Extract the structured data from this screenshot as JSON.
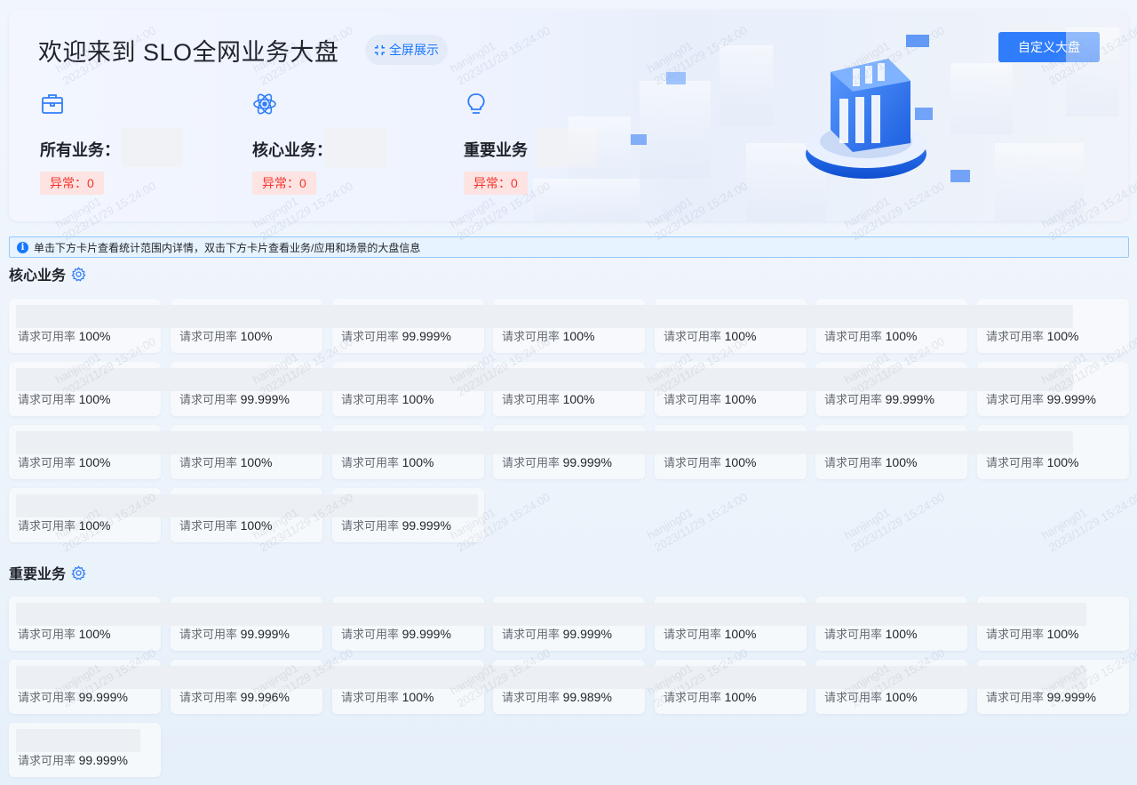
{
  "banner": {
    "title": "欢迎来到 SLO全网业务大盘",
    "fullscreen_label": "全屏展示",
    "custom_label": "自定义大盘",
    "stats": [
      {
        "label": "所有业务：",
        "abnormal": "异常：0"
      },
      {
        "label": "核心业务：",
        "abnormal": "异常：0"
      },
      {
        "label": "重要业务",
        "abnormal": "异常：0"
      }
    ]
  },
  "info": "单击下方卡片查看统计范围内详情，双击下方卡片查看业务/应用和场景的大盘信息",
  "metric_label": "请求可用率",
  "sections": [
    {
      "title": "核心业务",
      "rows": [
        [
          "100%",
          "100%",
          "99.999%",
          "100%",
          "100%",
          "100%",
          "100%"
        ],
        [
          "100%",
          "99.999%",
          "100%",
          "100%",
          "100%",
          "99.999%",
          "99.999%"
        ],
        [
          "100%",
          "100%",
          "100%",
          "99.999%",
          "100%",
          "100%",
          "100%"
        ],
        [
          "100%",
          "100%",
          "99.999%"
        ]
      ]
    },
    {
      "title": "重要业务",
      "rows": [
        [
          "100%",
          "99.999%",
          "99.999%",
          "99.999%",
          "100%",
          "100%",
          "100%"
        ],
        [
          "99.999%",
          "99.996%",
          "100%",
          "99.989%",
          "100%",
          "100%",
          "99.999%"
        ],
        [
          "99.999%"
        ]
      ]
    }
  ],
  "watermark": {
    "user": "hanjing01",
    "time": "2023/11/29 15:24:00"
  },
  "colors": {
    "primary": "#2f7dfa",
    "abnormal": "#f5342b",
    "info_border": "#91caff"
  }
}
